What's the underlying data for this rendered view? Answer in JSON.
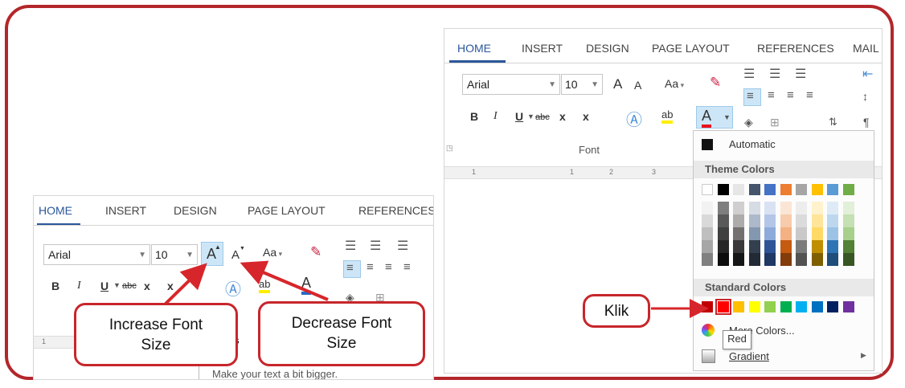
{
  "left_ribbon": {
    "tabs": [
      "HOME",
      "INSERT",
      "DESIGN",
      "PAGE LAYOUT",
      "REFERENCES"
    ],
    "font_name": "Arial",
    "font_size": "10",
    "increase_font_label": "A",
    "decrease_font_label": "A",
    "change_case_label": "Aa",
    "bold": "B",
    "italic": "I",
    "underline": "U",
    "strike": "abc",
    "subscript": "x",
    "superscript": "x",
    "ruler_tick": "1",
    "tooltip_text": "eas",
    "tooltip_desc": "Make your text a bit bigger."
  },
  "callouts": {
    "increase": "Increase Font Size",
    "decrease": "Decrease Font Size",
    "klik": "Klik"
  },
  "right_ribbon": {
    "tabs": [
      "HOME",
      "INSERT",
      "DESIGN",
      "PAGE LAYOUT",
      "REFERENCES",
      "MAIL"
    ],
    "font_name": "Arial",
    "font_size": "10",
    "increase_font_label": "A",
    "decrease_font_label": "A",
    "change_case_label": "Aa",
    "bold": "B",
    "italic": "I",
    "underline": "U",
    "strike": "abc",
    "subscript": "x",
    "superscript": "x",
    "group_label": "Font",
    "ruler_ticks": [
      "1",
      "1",
      "2",
      "3"
    ]
  },
  "color_menu": {
    "automatic": "Automatic",
    "theme_header": "Theme Colors",
    "standard_header": "Standard Colors",
    "more_colors": "More Colors...",
    "gradient": "Gradient",
    "tooltip": "Red",
    "theme_top": [
      "#ffffff",
      "#000000",
      "#e7e6e6",
      "#44546a",
      "#4472c4",
      "#ed7d31",
      "#a5a5a5",
      "#ffc000",
      "#5b9bd5",
      "#70ad47"
    ],
    "theme_shades": [
      [
        "#f2f2f2",
        "#d9d9d9",
        "#bfbfbf",
        "#a6a6a6",
        "#808080"
      ],
      [
        "#7f7f7f",
        "#595959",
        "#404040",
        "#262626",
        "#0d0d0d"
      ],
      [
        "#d0cece",
        "#aeabab",
        "#757070",
        "#3a3838",
        "#171616"
      ],
      [
        "#d6dce4",
        "#adb9ca",
        "#8497b0",
        "#333f4f",
        "#222a35"
      ],
      [
        "#d9e2f3",
        "#b4c6e7",
        "#8eaadb",
        "#2f5496",
        "#1f3864"
      ],
      [
        "#fbe5d5",
        "#f7cbac",
        "#f4b183",
        "#c55a11",
        "#833c0b"
      ],
      [
        "#ededed",
        "#dbdbdb",
        "#c9c9c9",
        "#7b7b7b",
        "#525252"
      ],
      [
        "#fff2cc",
        "#fee599",
        "#ffd966",
        "#bf8f00",
        "#7f6000"
      ],
      [
        "#deebf6",
        "#bdd7ee",
        "#9cc3e5",
        "#2e75b5",
        "#1e4e79"
      ],
      [
        "#e2efd9",
        "#c5e0b3",
        "#a8d08d",
        "#538135",
        "#375623"
      ]
    ],
    "standard": [
      "#c00000",
      "#ff0000",
      "#ffc000",
      "#ffff00",
      "#92d050",
      "#00b050",
      "#00b0f0",
      "#0070c0",
      "#002060",
      "#7030a0"
    ]
  }
}
